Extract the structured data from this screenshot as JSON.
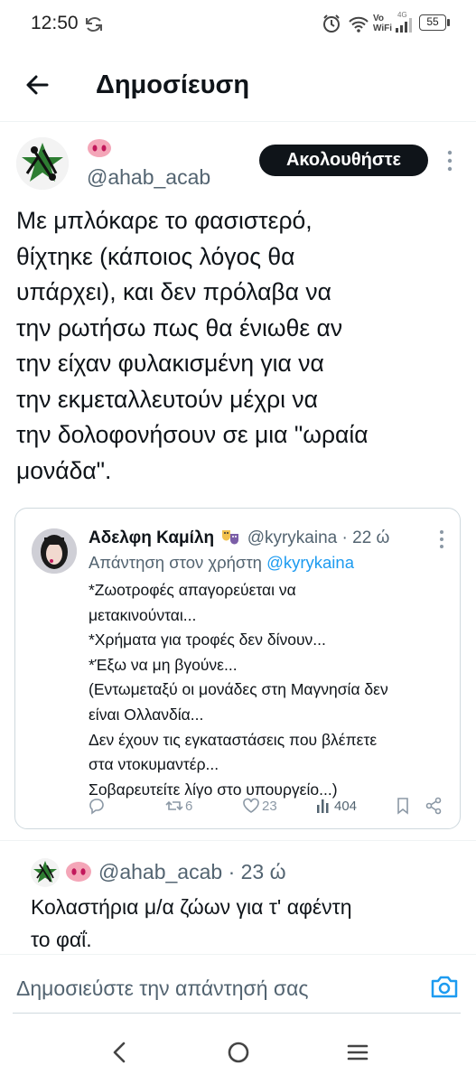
{
  "status_bar": {
    "time": "12:50",
    "battery": "55",
    "network": "4G",
    "vo": "Vo",
    "wifi": "WiFi"
  },
  "header": {
    "title": "Δημοσίευση"
  },
  "tweet": {
    "handle": "@ahab_acab",
    "follow_label": "Ακολουθήστε",
    "body": "Με μπλόκαρε το φασιστερό,\nθίχτηκε (κάποιος λόγος θα\nυπάρχει), και δεν πρόλαβα να\nτην ρωτήσω πως θα ένιωθε αν\nτην είχαν φυλακισμένη για να\nτην εκμεταλλευτούν μέχρι να\nτην δολοφονήσουν σε μια \"ωραία\nμονάδα\"."
  },
  "quoted": {
    "name": "Αδελφη Καμίλη",
    "handle": "@kyrykaina",
    "separator": " · ",
    "time": "22 ώ",
    "replying_prefix": "Απάντηση στον χρήστη ",
    "replying_handle": "@kyrykaina",
    "body": "*Ζωοτροφές απαγορεύεται να\nμετακινούνται...\n*Χρήματα για τροφές δεν δίνουν...\n*Έξω να μη βγούνε...\n(Εντωμεταξύ οι μονάδες στη Μαγνησία δεν\nείναι Ολλανδία...\nΔεν έχουν τις εγκαταστάσεις που βλέπετε\nστα ντοκυμαντέρ...\nΣοβαρευτείτε λίγο στο υπουργείο...)",
    "actions": {
      "reply": "",
      "retweet": "6",
      "like": "23",
      "views": "404"
    }
  },
  "reply": {
    "handle": "@ahab_acab",
    "separator": " · ",
    "time": "23 ώ",
    "body": "Κολαστήρια μ/α ζώων για τ' αφέντη\nτο φαΐ."
  },
  "compose": {
    "placeholder": "Δημοσιεύστε την απάντησή σας"
  },
  "colors": {
    "accent": "#1d9bf0",
    "text": "#0f1419",
    "muted": "#536471",
    "border": "#cfd9de",
    "pig": "#f4a6b8"
  },
  "icons": [
    "back-arrow-icon",
    "more-vert-icon",
    "reply-icon",
    "retweet-icon",
    "like-icon",
    "views-icon",
    "bookmark-icon",
    "share-icon",
    "camera-icon",
    "nav-back-icon",
    "nav-home-icon",
    "nav-recents-icon"
  ]
}
